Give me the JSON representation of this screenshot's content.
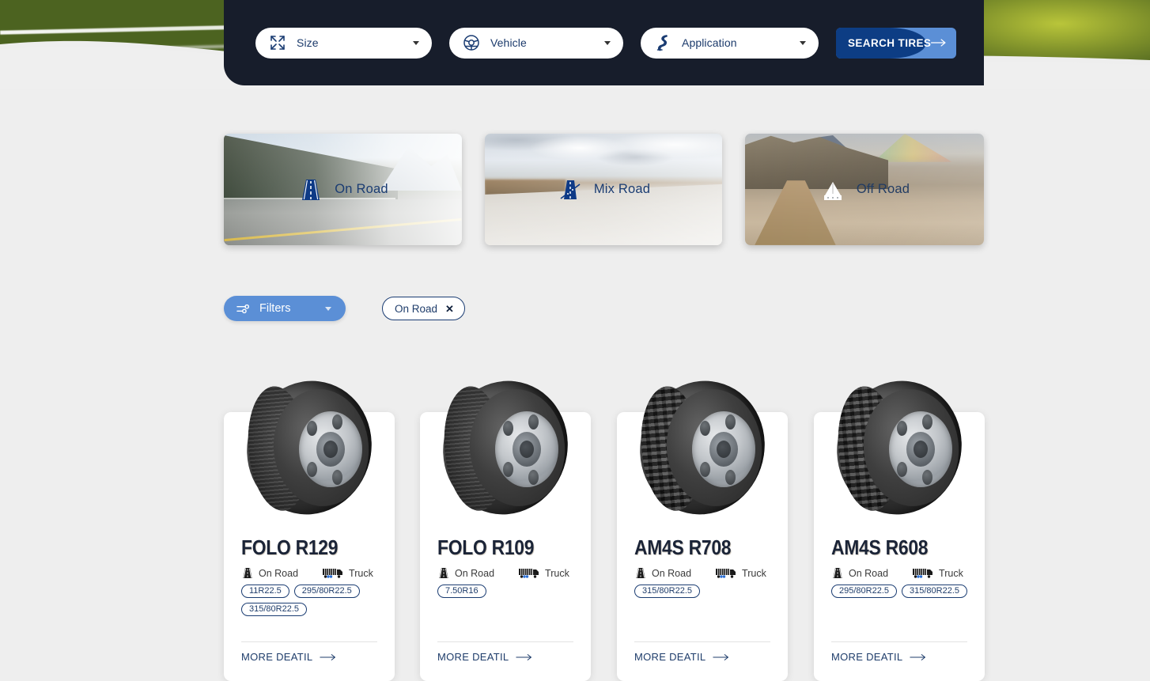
{
  "hero": {
    "alt": "highway-road-banner"
  },
  "search_panel": {
    "background": "#171d2b",
    "dropdowns": [
      {
        "label": "Size",
        "icon": "resize-arrows-icon",
        "name": "size"
      },
      {
        "label": "Vehicle",
        "icon": "steering-wheel-icon",
        "name": "vehicle"
      },
      {
        "label": "Application",
        "icon": "winding-road-icon",
        "name": "application"
      }
    ],
    "search_button": {
      "label": "SEARCH TIRES",
      "icon": "arrow-right-icon",
      "color_dark": "#0d3d84",
      "color_light": "#5b8fd6"
    }
  },
  "categories": [
    {
      "label": "On Road",
      "icon": "road-icon",
      "name": "on-road"
    },
    {
      "label": "Mix Road",
      "icon": "mix-road-icon",
      "name": "mix-road"
    },
    {
      "label": "Off Road",
      "icon": "off-road-mountain-icon",
      "name": "off-road"
    }
  ],
  "filter_bar": {
    "filters_label": "Filters",
    "filters_icon": "sliders-icon",
    "filters_color": "#5b8fd6",
    "active_chips": [
      {
        "label": "On Road",
        "remove_icon": "close-icon"
      }
    ]
  },
  "products": [
    {
      "title": "FOLO R129",
      "terrain": "On Road",
      "vehicle": "Truck",
      "sizes": [
        "11R22.5",
        "295/80R22.5",
        "315/80R22.5"
      ],
      "more_label": "MORE DEATIL",
      "tread": "rib"
    },
    {
      "title": "FOLO R109",
      "terrain": "On Road",
      "vehicle": "Truck",
      "sizes": [
        "7.50R16"
      ],
      "more_label": "MORE DEATIL",
      "tread": "rib"
    },
    {
      "title": "AM4S R708",
      "terrain": "On Road",
      "vehicle": "Truck",
      "sizes": [
        "315/80R22.5"
      ],
      "more_label": "MORE DEATIL",
      "tread": "block"
    },
    {
      "title": "AM4S R608",
      "terrain": "On Road",
      "vehicle": "Truck",
      "sizes": [
        "295/80R22.5",
        "315/80R22.5"
      ],
      "more_label": "MORE DEATIL",
      "tread": "block"
    }
  ],
  "colors": {
    "page_bg": "#eeeeee",
    "panel_dark": "#171d2b",
    "navy": "#1a3c72",
    "accent_blue": "#5b8fd6"
  }
}
